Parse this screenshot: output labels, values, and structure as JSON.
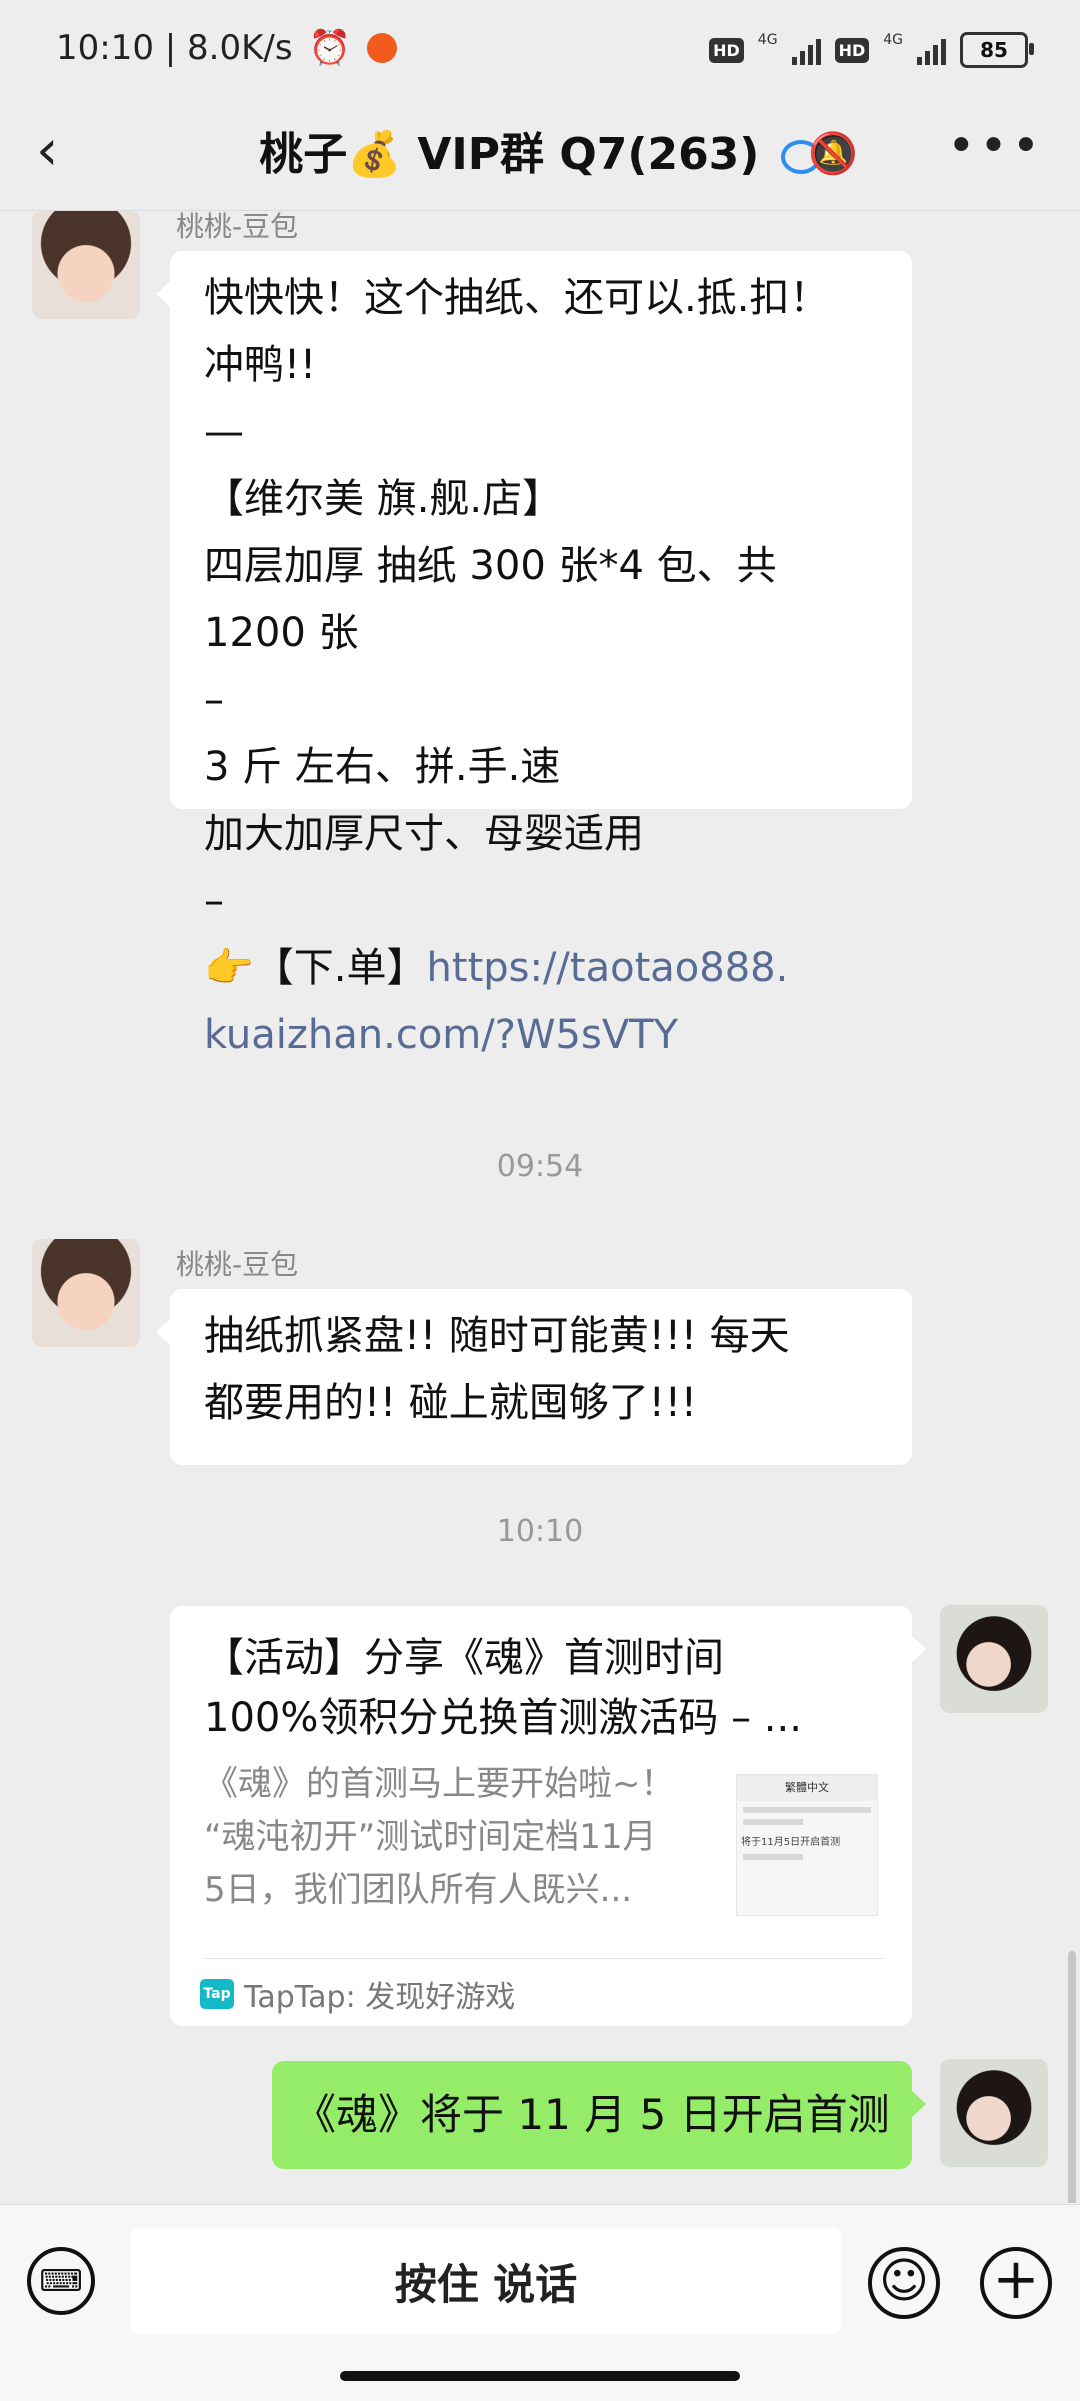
{
  "status_bar": {
    "time_speed": "10:10 | 8.0K/s",
    "hd1": "HD",
    "net1": "4G",
    "hd2": "HD",
    "net2": "4G",
    "battery": "85"
  },
  "header": {
    "title": "桃子💰 VIP群 Q7(263)"
  },
  "messages": [
    {
      "sender": "桃桃-豆包",
      "lines": [
        "快快快！这个抽纸、还可以.抵.扣！",
        "冲鸭!!",
        "—",
        "【维尔美 旗.舰.店】",
        "四层加厚 抽纸 300 张*4 包、共",
        "1200 张",
        "–",
        "3 斤 左右、拼.手.速",
        "加大加厚尺寸、母婴适用",
        "–"
      ],
      "link_prefix": "👉【下.单】",
      "link_line1": "https://taotao888.",
      "link_line2": "kuaizhan.com/?W5sVTY"
    },
    {
      "time": "09:54"
    },
    {
      "sender": "桃桃-豆包",
      "lines": [
        "抽纸抓紧盘!! 随时可能黄!!! 每天",
        "都要用的!! 碰上就囤够了!!!"
      ]
    },
    {
      "time": "10:10"
    }
  ],
  "share_card": {
    "title_line1": "【活动】分享《魂》首测时间",
    "title_line2": "100%领积分兑换首测激活码 – ...",
    "desc_line1": "《魂》的首测马上要开始啦~！",
    "desc_line2": "“魂沌初开”测试时间定档11月",
    "desc_line3": "5日，我们团队所有人既兴...",
    "thumb_header": "繁體中文",
    "thumb_text": "将于11月5日开启首测",
    "source": "TapTap: 发现好游戏",
    "source_icon": "Tap"
  },
  "my_message": "《魂》将于 11 月 5 日开启首测",
  "input_bar": {
    "voice_label": "按住 说话"
  },
  "colors": {
    "background": "#ededed",
    "bubble_green": "#95ec69",
    "link": "#576b95",
    "taptap": "#14b9c8"
  }
}
